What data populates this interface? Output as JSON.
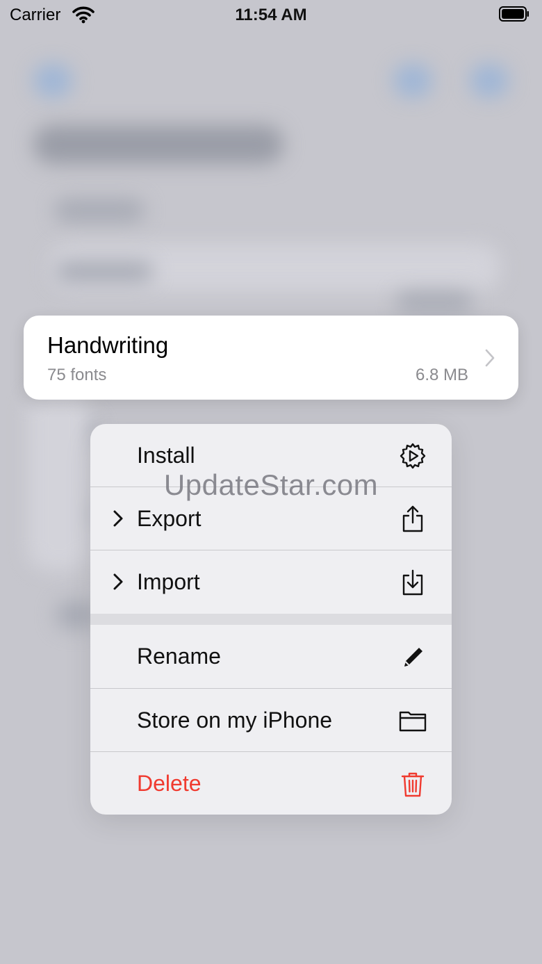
{
  "status_bar": {
    "carrier": "Carrier",
    "time": "11:54 AM"
  },
  "card": {
    "title": "Handwriting",
    "subtitle": "75 fonts",
    "size": "6.8 MB"
  },
  "menu": {
    "items": [
      {
        "label": "Install",
        "icon": "gear-play-icon",
        "submenu": false
      },
      {
        "label": "Export",
        "icon": "share-icon",
        "submenu": true
      },
      {
        "label": "Import",
        "icon": "download-icon",
        "submenu": true
      },
      {
        "label": "Rename",
        "icon": "pencil-icon",
        "submenu": false
      },
      {
        "label": "Store on my iPhone",
        "icon": "folder-icon",
        "submenu": false
      },
      {
        "label": "Delete",
        "icon": "trash-icon",
        "submenu": false,
        "destructive": true
      }
    ]
  },
  "watermark": "UpdateStar.com",
  "colors": {
    "destructive": "#f03a2f",
    "background": "#c6c6cd",
    "menu_background": "#efeff2"
  }
}
